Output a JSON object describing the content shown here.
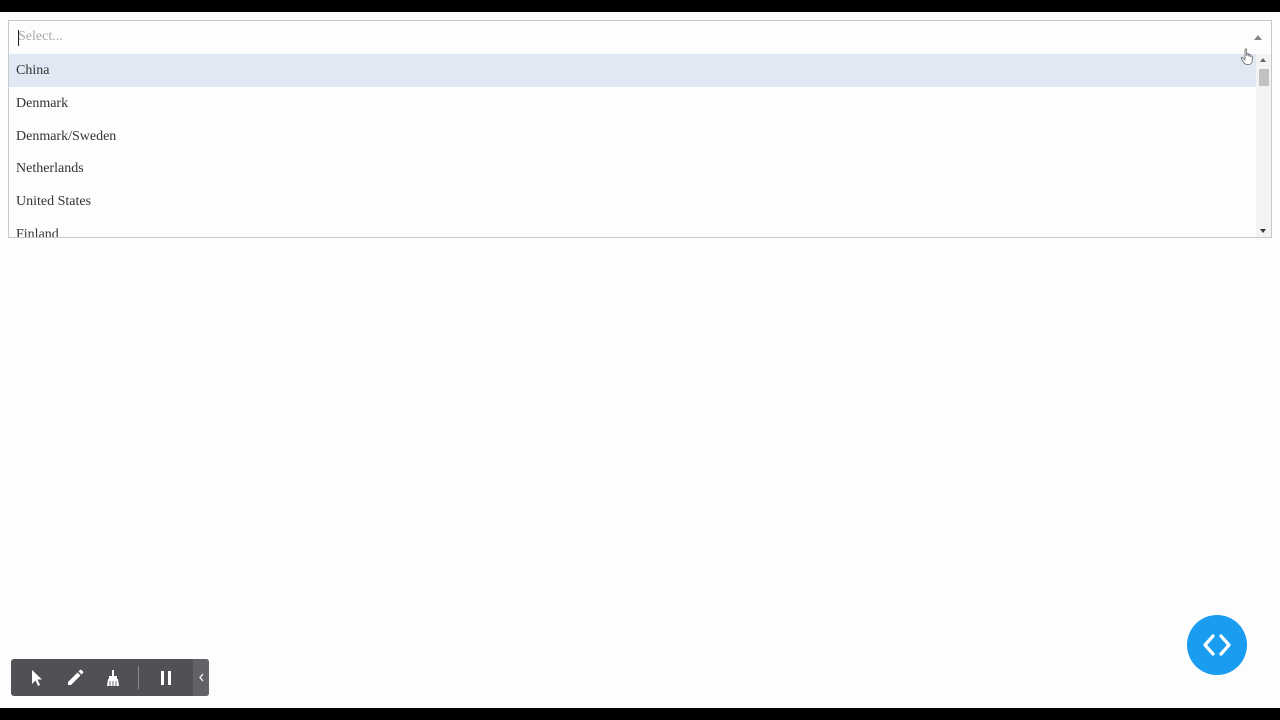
{
  "select": {
    "placeholder": "Select...",
    "value": "",
    "options": [
      {
        "label": "China",
        "focused": true
      },
      {
        "label": "Denmark"
      },
      {
        "label": "Denmark/Sweden"
      },
      {
        "label": "Netherlands"
      },
      {
        "label": "United States"
      },
      {
        "label": "Finland"
      }
    ]
  },
  "toolbar": {
    "tools": [
      "pointer-icon",
      "pencil-icon",
      "broom-icon",
      "pause-icon"
    ],
    "collapse_icon": "chevron-left-icon"
  },
  "fab": {
    "icon": "code-brackets-icon",
    "color": "#1a9cf0"
  },
  "colors": {
    "focused_option": "#dfe8f3",
    "toolbar_bg": "#505055"
  }
}
